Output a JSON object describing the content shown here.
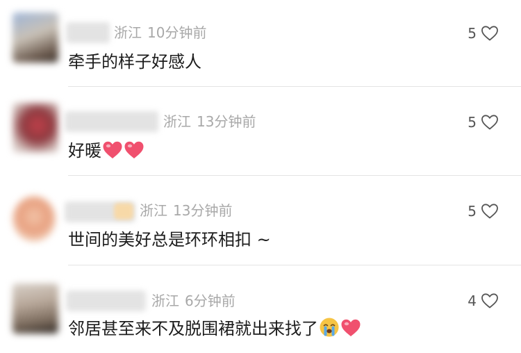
{
  "comments": [
    {
      "location": "浙江",
      "time": "10分钟前",
      "text": "牵手的样子好感人",
      "likes": "5",
      "emojis": []
    },
    {
      "location": "浙江",
      "time": "13分钟前",
      "text": "好暖",
      "likes": "5",
      "emojis": [
        "heart-emoji",
        "heart-emoji"
      ]
    },
    {
      "location": "浙江",
      "time": "13分钟前",
      "text": "世间的美好总是环环相扣 ~",
      "likes": "5",
      "emojis": []
    },
    {
      "location": "浙江",
      "time": "6分钟前",
      "text": "邻居甚至来不及脱围裙就出来找了",
      "likes": "4",
      "emojis": [
        "crying-face-emoji",
        "heart-emoji"
      ]
    }
  ],
  "colors": {
    "heart_emoji": "#f0506e",
    "meta_text": "#a8a8a8",
    "body_text": "#1c1c1c",
    "divider": "#e4e4e4"
  }
}
